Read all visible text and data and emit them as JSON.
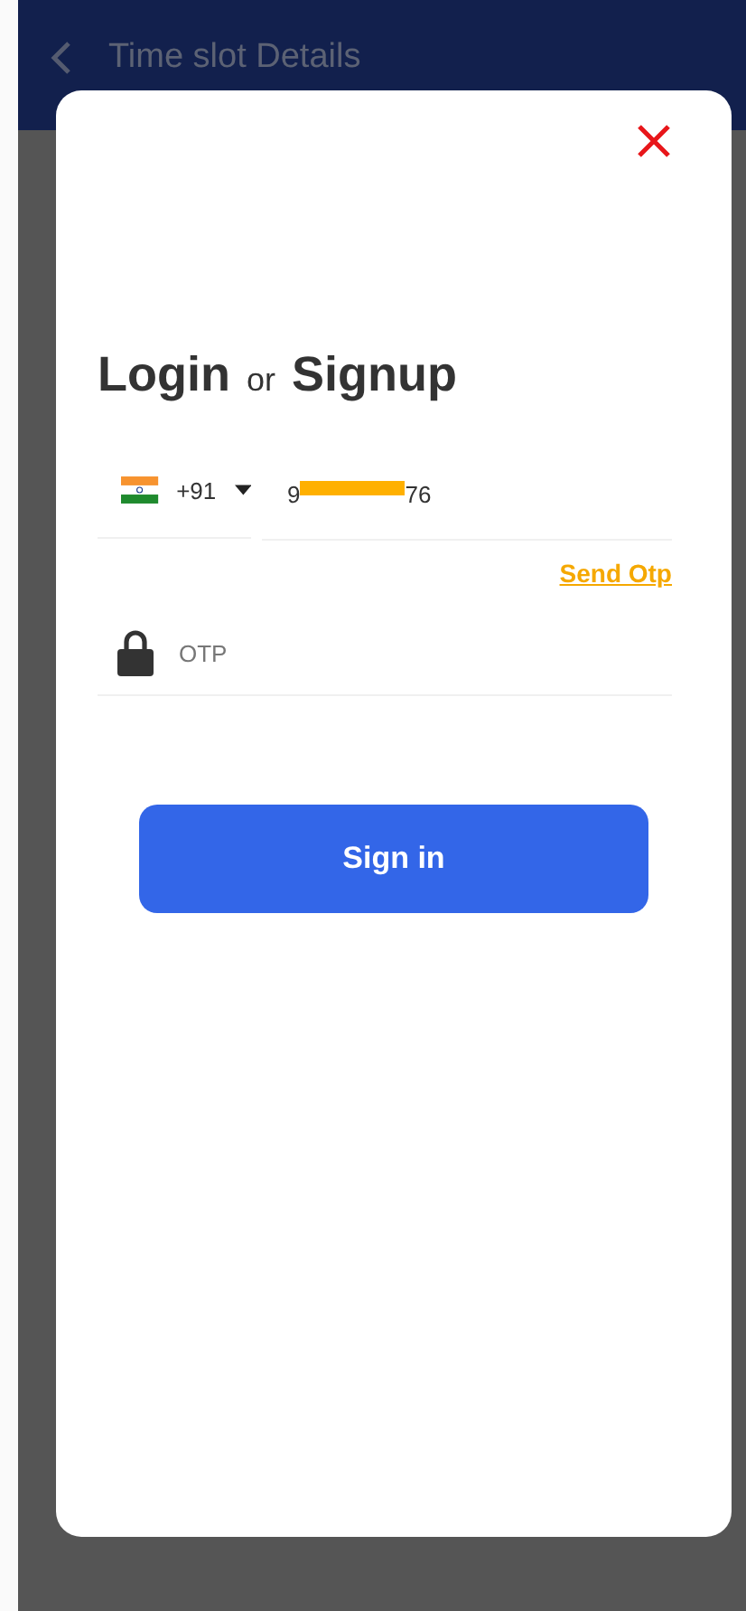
{
  "header": {
    "title": "Time slot Details"
  },
  "dialog": {
    "title_start": "Login",
    "title_joiner": "or",
    "title_end": "Signup",
    "country": {
      "code": "+91"
    },
    "phone": {
      "visible_start": "9",
      "visible_end": "76",
      "redacted": true
    },
    "send_otp": "Send Otp",
    "otp": {
      "placeholder": "OTP"
    },
    "sign_in": "Sign in"
  }
}
